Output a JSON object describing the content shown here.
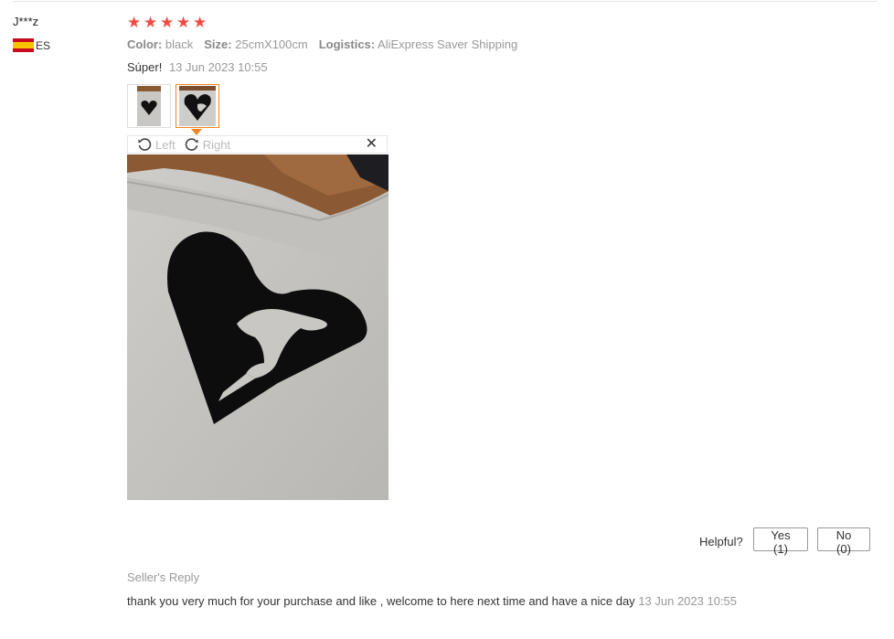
{
  "review": {
    "user": "J***z",
    "country": "ES",
    "rating": 5,
    "stars_color": "#f44b41",
    "attributes": [
      {
        "key": "Color:",
        "value": "black"
      },
      {
        "key": "Size:",
        "value": "25cmX100cm"
      },
      {
        "key": "Logistics:",
        "value": "AliExpress Saver Shipping"
      }
    ],
    "text": "Súper!",
    "date": "13 Jun 2023 10:55"
  },
  "viewer": {
    "rotate_left_label": "Left",
    "rotate_right_label": "Right",
    "close_icon": "close-icon",
    "accent": "#f08522"
  },
  "helpful": {
    "label": "Helpful?",
    "yes_label": "Yes (1)",
    "no_label": "No (0)"
  },
  "seller_reply": {
    "title": "Seller's Reply",
    "text": "thank you very much for your purchase and like , welcome to here next time and have a nice day",
    "date": "13 Jun 2023 10:55"
  }
}
